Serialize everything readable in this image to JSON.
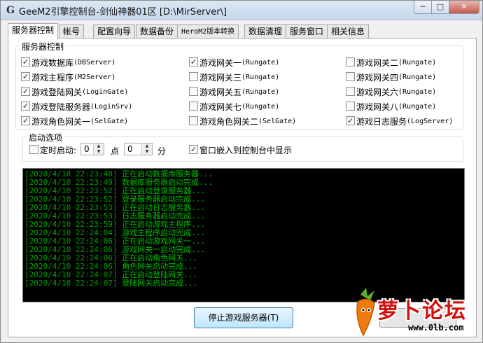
{
  "window": {
    "title": "GeeM2引擎控制台-剑仙神器01区 [D:\\MirServer\\]",
    "icon_letter": "G",
    "minimize": "─",
    "maximize": "□",
    "close": "✕"
  },
  "tabs": [
    {
      "label": "服务器控制"
    },
    {
      "label": "帐号"
    },
    {
      "label": "配置向导"
    },
    {
      "label": "数据备份"
    },
    {
      "label": "HeroM2版本转换"
    },
    {
      "label": "数据清理"
    },
    {
      "label": "服务窗口"
    },
    {
      "label": "相关信息"
    }
  ],
  "server_control": {
    "group_title": "服务器控制",
    "checkboxes": [
      {
        "cn": "游戏数据库",
        "en": "(DBServer)",
        "checked": true
      },
      {
        "cn": "游戏主程序",
        "en": "(M2Server)",
        "checked": true
      },
      {
        "cn": "游戏登陆网关",
        "en": "(LoginGate)",
        "checked": true
      },
      {
        "cn": "游戏登陆服务器",
        "en": "(LoginSrv)",
        "checked": true
      },
      {
        "cn": "游戏角色网关一",
        "en": "(SelGate)",
        "checked": true
      },
      {
        "cn": "游戏网关一",
        "en": "(Rungate)",
        "checked": true
      },
      {
        "cn": "游戏网关三",
        "en": "(Rungate)",
        "checked": false
      },
      {
        "cn": "游戏网关五",
        "en": "(Rungate)",
        "checked": false
      },
      {
        "cn": "游戏网关七",
        "en": "(Rungate)",
        "checked": false
      },
      {
        "cn": "游戏角色网关二",
        "en": "(SelGate)",
        "checked": false
      },
      {
        "cn": "游戏网关二",
        "en": "(Rungate)",
        "checked": false
      },
      {
        "cn": "游戏网关四",
        "en": "(Rungate)",
        "checked": false
      },
      {
        "cn": "游戏网关六",
        "en": "(Rungate)",
        "checked": false
      },
      {
        "cn": "游戏网关八",
        "en": "(Rungate)",
        "checked": false
      },
      {
        "cn": "游戏日志服务",
        "en": "(LogServer)",
        "checked": true
      }
    ]
  },
  "startup": {
    "group_title": "启动选项",
    "timed_label": "定时启动:",
    "timed_checked": false,
    "hour": "0",
    "hour_unit": "点",
    "minute": "0",
    "minute_unit": "分",
    "embed_label": "窗口嵌入到控制台中显示",
    "embed_checked": true
  },
  "log": [
    {
      "ts": "[2020/4/10 22:23:48]",
      "msg": "正在启动数据库服务器..."
    },
    {
      "ts": "[2020/4/10 22:23:49]",
      "msg": "数据库服务器启动完成..."
    },
    {
      "ts": "[2020/4/10 22:23:52]",
      "msg": "正在启动登录服务器..."
    },
    {
      "ts": "[2020/4/10 22:23:52]",
      "msg": "登录服务器启动完成..."
    },
    {
      "ts": "[2020/4/10 22:23:53]",
      "msg": "正在启动日志服务器..."
    },
    {
      "ts": "[2020/4/10 22:23:53]",
      "msg": "日志服务器启动完成..."
    },
    {
      "ts": "[2020/4/10 22:23:59]",
      "msg": "正在启动游戏主程序..."
    },
    {
      "ts": "[2020/4/10 22:24:04]",
      "msg": "游戏主程序启动完成..."
    },
    {
      "ts": "[2020/4/10 22:24:06]",
      "msg": "正在启动游戏网关一..."
    },
    {
      "ts": "[2020/4/10 22:24:06]",
      "msg": "游戏网关一启动完成..."
    },
    {
      "ts": "[2020/4/10 22:24:06]",
      "msg": "正在启动角色网关..."
    },
    {
      "ts": "[2020/4/10 22:24:06]",
      "msg": "角色网关启动完成..."
    },
    {
      "ts": "[2020/4/10 22:24:07]",
      "msg": "正在启动登陆网关..."
    },
    {
      "ts": "[2020/4/10 22:24:07]",
      "msg": "登陆网关启动完成..."
    }
  ],
  "buttons": {
    "stop": "停止游戏服务器(T)"
  },
  "watermark": {
    "text": "萝卜论坛",
    "url": "www.0lb.com"
  },
  "colors": {
    "log_bg": "#000000",
    "log_text": "#00c000",
    "watermark": "#d10f0f"
  }
}
